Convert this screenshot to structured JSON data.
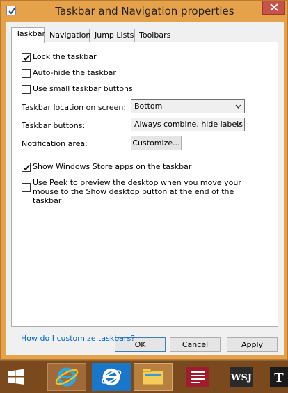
{
  "window": {
    "title": "Taskbar and Navigation properties",
    "accent": "#e6a24a",
    "close_color": "#c7524a"
  },
  "tabs": [
    {
      "label": "Taskbar",
      "active": true
    },
    {
      "label": "Navigation",
      "active": false
    },
    {
      "label": "Jump Lists",
      "active": false
    },
    {
      "label": "Toolbars",
      "active": false
    }
  ],
  "options": {
    "lock_taskbar": {
      "label": "Lock the taskbar",
      "checked": true
    },
    "auto_hide": {
      "label": "Auto-hide the taskbar",
      "checked": false
    },
    "small_buttons": {
      "label": "Use small taskbar buttons",
      "checked": false
    },
    "show_store_apps": {
      "label": "Show Windows Store apps on the taskbar",
      "checked": true
    },
    "use_peek": {
      "label": "Use Peek to preview the desktop when you move your mouse to the Show desktop button at the end of the taskbar",
      "checked": false
    }
  },
  "fields": {
    "location": {
      "label": "Taskbar location on screen:",
      "value": "Bottom"
    },
    "buttons": {
      "label": "Taskbar buttons:",
      "value": "Always combine, hide labels"
    },
    "notification": {
      "label": "Notification area:",
      "button_label": "Customize..."
    }
  },
  "help_link": "How do I customize taskbars?",
  "dialog_buttons": {
    "ok": "OK",
    "cancel": "Cancel",
    "apply": "Apply"
  },
  "taskbar": {
    "items": [
      "start-icon",
      "internet-explorer-icon",
      "internet-explorer-metro-icon",
      "file-explorer-icon",
      "red-app-icon",
      "wsj-icon",
      "nyt-icon"
    ],
    "wsj_text": "WSJ",
    "nyt_text": "T"
  }
}
